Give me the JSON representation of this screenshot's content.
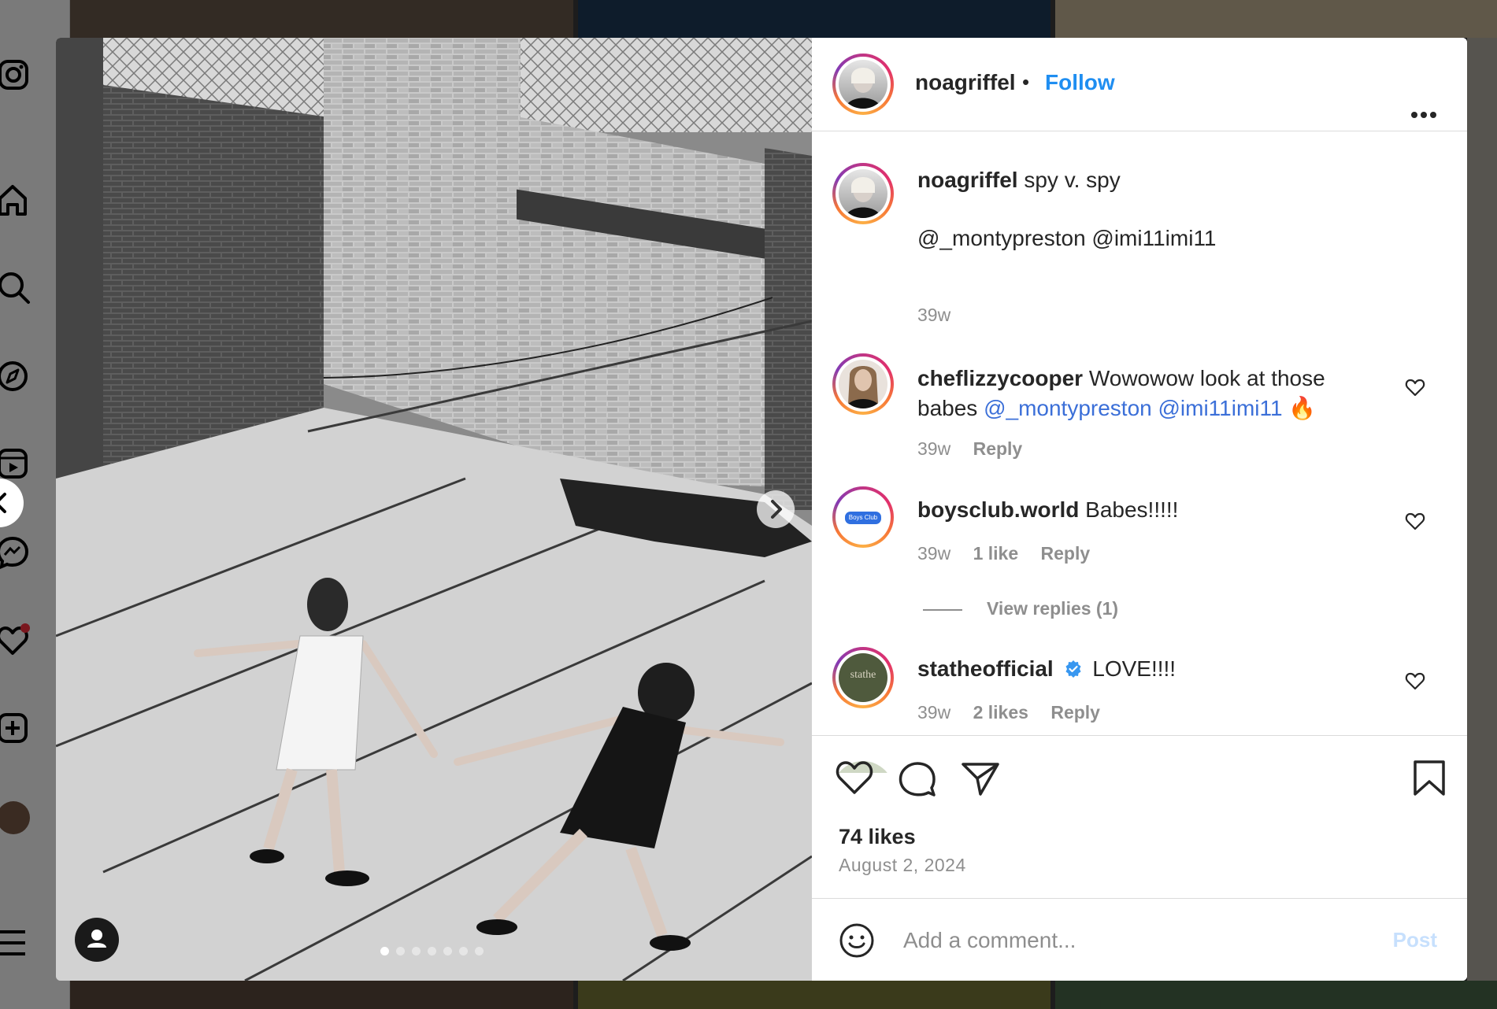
{
  "post": {
    "username": "noagriffel",
    "follow_label": "Follow",
    "separator": "•",
    "more_label": "•••",
    "caption": {
      "username": "noagriffel",
      "text": "spy v. spy",
      "mentions": "@_montypreston @imi11imi11",
      "time": "39w"
    },
    "comments": [
      {
        "username": "cheflizzycooper",
        "text_part1": "Wowowow look at those",
        "text_part2": "babes",
        "mentions": "@_montypreston @imi11imi11",
        "emoji": "🔥",
        "time": "39w",
        "reply": "Reply"
      },
      {
        "username": "boysclub.world",
        "avatar_text": "Boys Club",
        "text": "Babes!!!!!",
        "time": "39w",
        "likes": "1 like",
        "reply": "Reply",
        "view_replies": "View replies (1)"
      },
      {
        "username": "statheofficial",
        "avatar_text": "stathe",
        "verified": true,
        "text": "LOVE!!!!",
        "time": "39w",
        "likes": "2 likes",
        "reply": "Reply"
      },
      {
        "username": "",
        "text": "",
        "partial": true
      }
    ],
    "likes": "74 likes",
    "date": "August 2, 2024",
    "comment_placeholder": "Add a comment...",
    "post_button": "Post",
    "carousel": {
      "count": 7,
      "active": 0
    }
  },
  "icons": {
    "nav": [
      "instagram-icon",
      "home-icon",
      "search-icon",
      "explore-icon",
      "reels-icon",
      "messenger-icon",
      "notifications-icon",
      "create-icon",
      "profile-avatar",
      "more-menu-icon"
    ],
    "actions": [
      "like-icon",
      "comment-icon",
      "share-icon",
      "save-icon"
    ],
    "photo": [
      "tagged-user-icon",
      "next-arrow-icon",
      "prev-arrow-icon"
    ]
  },
  "colors": {
    "follow": "#1f8ef1",
    "mention": "#3b6fd8",
    "verified": "#3897f0",
    "notification_dot": "#ff3040",
    "post_disabled": "#c7e0fd"
  }
}
